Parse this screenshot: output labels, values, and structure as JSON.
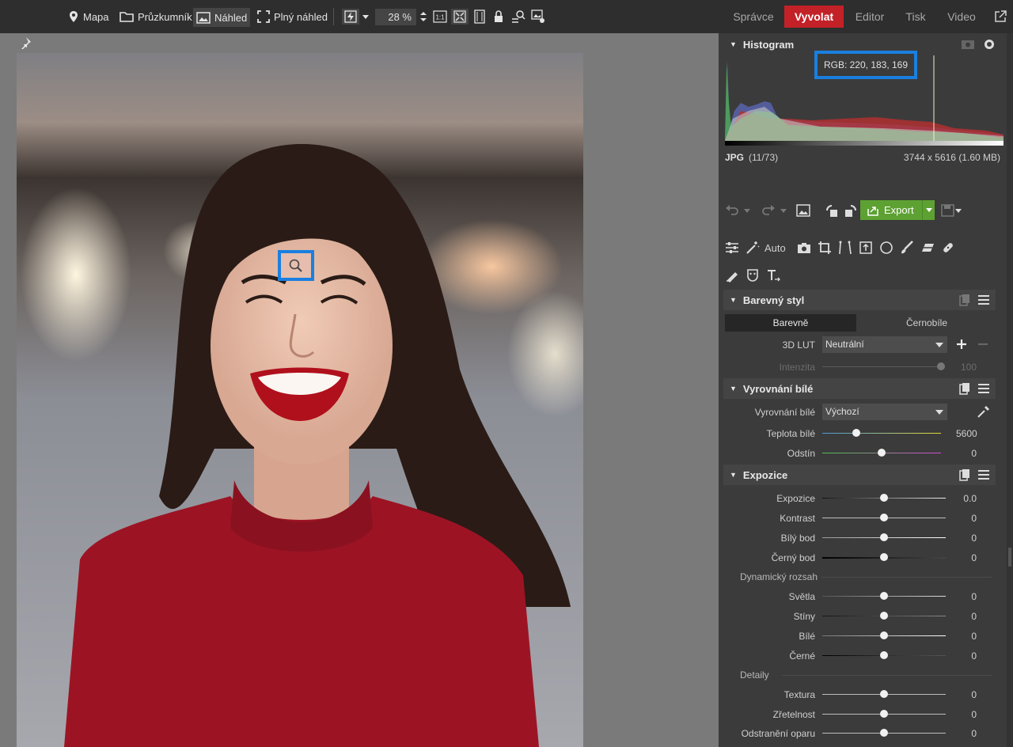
{
  "topbar": {
    "map_label": "Mapa",
    "explorer_label": "Průzkumník",
    "preview_label": "Náhled",
    "fullpreview_label": "Plný náhled",
    "zoom_value": "28 %",
    "modes": [
      "Správce",
      "Vyvolat",
      "Editor",
      "Tisk",
      "Video"
    ],
    "active_mode": "Vyvolat"
  },
  "histogram": {
    "title": "Histogram",
    "rgb_readout": "RGB: 220, 183, 169",
    "file_type": "JPG",
    "file_index": "(11/73)",
    "dimensions": "3744 x 5616 (1.60 MB)"
  },
  "toolbar": {
    "export_label": "Export",
    "auto_label": "Auto"
  },
  "color_style": {
    "title": "Barevný styl",
    "tabs": [
      "Barevně",
      "Černobíle"
    ],
    "lut_label": "3D LUT",
    "lut_value": "Neutrální",
    "intensity_label": "Intenzita",
    "intensity_value": "100"
  },
  "white_balance": {
    "title": "Vyrovnání bílé",
    "wb_label": "Vyrovnání bílé",
    "wb_value": "Výchozí",
    "temp_label": "Teplota bílé",
    "temp_value": "5600",
    "tint_label": "Odstín",
    "tint_value": "0"
  },
  "exposure": {
    "title": "Expozice",
    "rows": [
      {
        "label": "Expozice",
        "value": "0.0"
      },
      {
        "label": "Kontrast",
        "value": "0"
      },
      {
        "label": "Bílý bod",
        "value": "0"
      },
      {
        "label": "Černý bod",
        "value": "0"
      }
    ],
    "dynamic_title": "Dynamický rozsah",
    "dynamic_rows": [
      {
        "label": "Světla",
        "value": "0"
      },
      {
        "label": "Stíny",
        "value": "0"
      },
      {
        "label": "Bílé",
        "value": "0"
      },
      {
        "label": "Černé",
        "value": "0"
      }
    ],
    "detail_title": "Detaily",
    "detail_rows": [
      {
        "label": "Textura",
        "value": "0"
      },
      {
        "label": "Zřetelnost",
        "value": "0"
      },
      {
        "label": "Odstranění oparu",
        "value": "0"
      }
    ]
  },
  "colors": {
    "accent_red": "#c32128",
    "export_green": "#5da132",
    "highlight_blue": "#1a7fe0"
  }
}
